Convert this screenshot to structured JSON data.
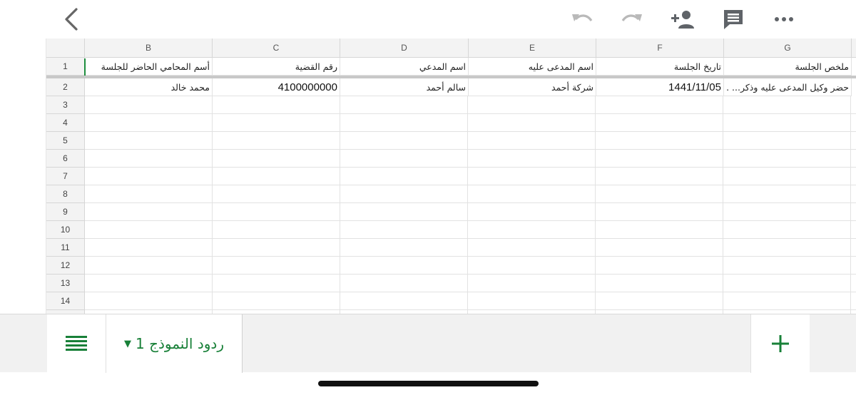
{
  "toolbar": {
    "icons": [
      "back-chevron-icon",
      "undo-icon",
      "redo-icon",
      "add-person-icon",
      "comment-icon",
      "more-icon"
    ]
  },
  "columns": [
    "B",
    "C",
    "D",
    "E",
    "F",
    "G"
  ],
  "rows": [
    "1",
    "2",
    "3",
    "4",
    "5",
    "6",
    "7",
    "8",
    "9",
    "10",
    "11",
    "12",
    "13",
    "14"
  ],
  "cells": {
    "row1": {
      "B": "أسم المحامي الحاضر للجلسة",
      "C": "رقم القضية",
      "D": "اسم المدعي",
      "E": "اسم المدعى عليه",
      "F": "تاريخ الجلسة",
      "G": "ملخص الجلسة"
    },
    "row2": {
      "B": "محمد خالد",
      "C": "4100000000",
      "D": "سالم أحمد",
      "E": "شركة أحمد",
      "F": "1441/11/05",
      "G": "حضر وكيل المدعى عليه وذكر... ."
    }
  },
  "sheet_tab": {
    "label": "ردود النموذج 1",
    "dropdown_icon": "triangle-down-icon"
  },
  "colors": {
    "accent": "#188038",
    "header_bg": "#f3f3f3",
    "icon_gray": "#5f6368"
  }
}
